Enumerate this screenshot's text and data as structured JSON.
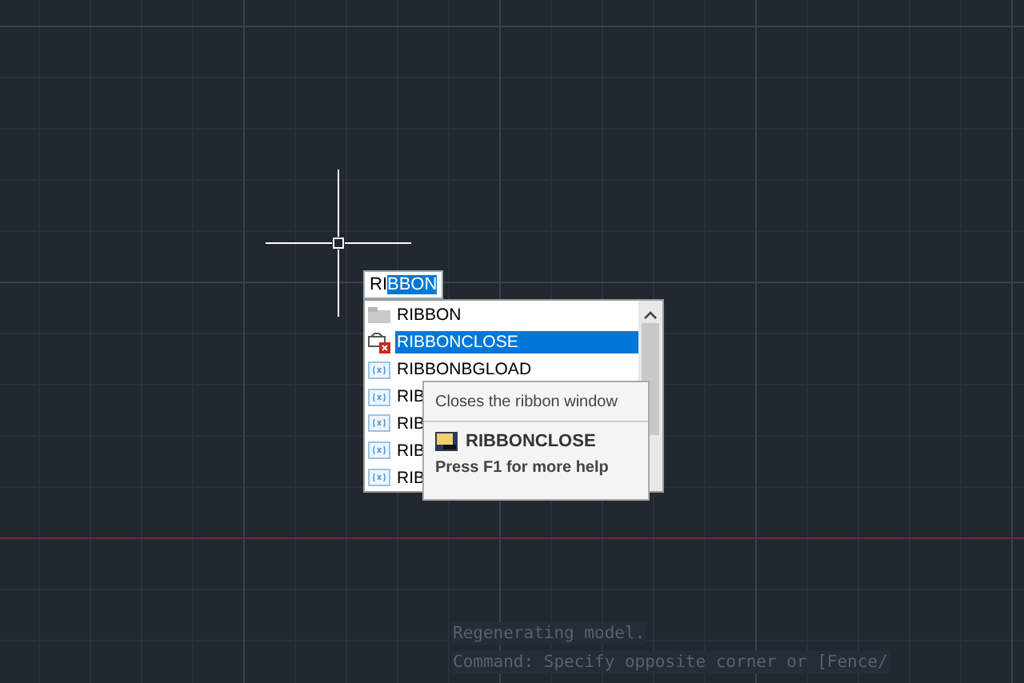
{
  "command_input": {
    "typed": "RI",
    "selected_text": "BBON"
  },
  "suggestions": [
    {
      "label": "RIBBON",
      "kind": "folder",
      "selected": false
    },
    {
      "label": "RIBBONCLOSE",
      "kind": "close",
      "selected": true
    },
    {
      "label": "RIBBONBGLOAD",
      "kind": "variable",
      "selected": false
    },
    {
      "label": "RIB",
      "kind": "variable",
      "selected": false
    },
    {
      "label": "RIB",
      "kind": "variable",
      "selected": false
    },
    {
      "label": "RIB",
      "kind": "variable",
      "selected": false
    },
    {
      "label": "RIB",
      "kind": "variable",
      "selected": false
    }
  ],
  "tooltip": {
    "description": "Closes the ribbon window",
    "command": "RIBBONCLOSE",
    "help": "Press F1 for more help"
  },
  "command_history": [
    "Regenerating model.",
    "Command: Specify opposite corner or [Fence/"
  ]
}
